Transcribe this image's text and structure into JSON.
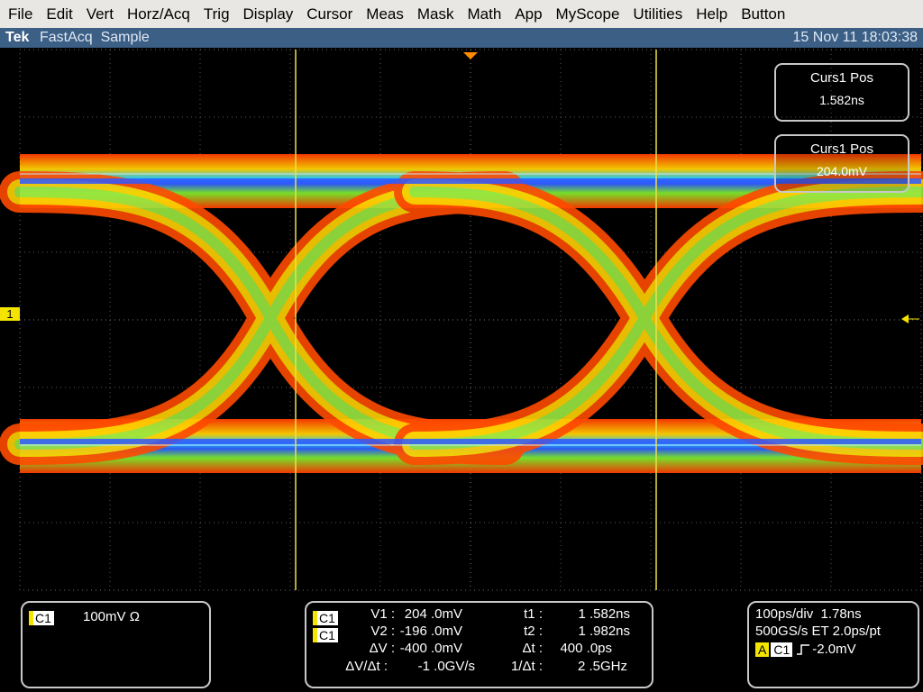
{
  "menu": [
    "File",
    "Edit",
    "Vert",
    "Horz/Acq",
    "Trig",
    "Display",
    "Cursor",
    "Meas",
    "Mask",
    "Math",
    "App",
    "MyScope",
    "Utilities",
    "Help",
    "Button"
  ],
  "titlebar": {
    "logo": "Tek",
    "mode": "FastAcq  Sample",
    "datetime": "15 Nov 11 18:03:38"
  },
  "screen": {
    "channel_marker": "1",
    "curs1_pos_a": {
      "title": "Curs1 Pos",
      "value": "1.582ns"
    },
    "curs1_pos_b": {
      "title": "Curs1 Pos",
      "value": "204.0mV"
    }
  },
  "channel_panel": {
    "tag": "C1",
    "scale": "100mV Ω"
  },
  "cursor_panel": {
    "tag1": "C1",
    "tag2": "C1",
    "v1_label": "V1 :",
    "v1": "204 .0mV",
    "v2_label": "V2 :",
    "v2": "-196 .0mV",
    "dv_label": "ΔV :",
    "dv": "-400 .0mV",
    "dvdt_label": "ΔV/Δt :",
    "dvdt": "-1 .0GV/s",
    "t1_label": "t1 :",
    "t1": "1 .582ns",
    "t2_label": "t2 :",
    "t2": "1 .982ns",
    "dt_label": "Δt :",
    "dt": "400 .0ps",
    "inv_dt_label": "1/Δt :",
    "inv_dt": "2 .5GHz"
  },
  "horiz_panel": {
    "line1": "100ps/div  1.78ns",
    "line2": "500GS/s ET 2.0ps/pt",
    "trig_tag_a": "A",
    "trig_tag_ch": "C1",
    "trig_level": "-2.0mV"
  },
  "colors": {
    "cursor": "#ece04a",
    "channel": "#f5e400",
    "panel_border": "#c8c8c8",
    "titlebar": "#3c5f86"
  }
}
